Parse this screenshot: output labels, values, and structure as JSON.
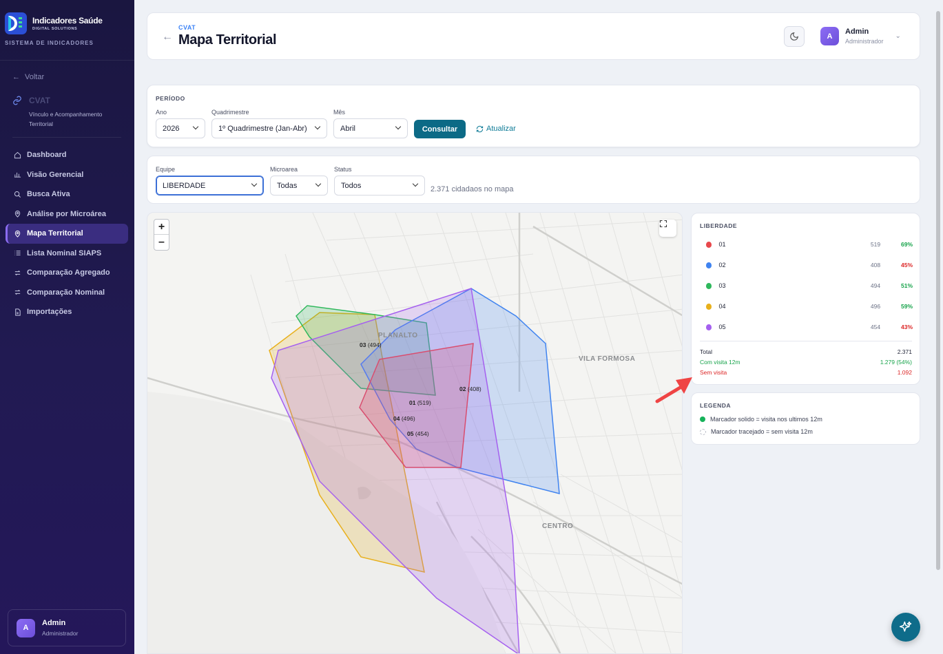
{
  "brand": {
    "name": "Indicadores Saúde",
    "sub": "DIGITAL SOLUTIONS",
    "system": "SISTEMA DE INDICADORES"
  },
  "sidebar": {
    "back_label": "Voltar",
    "module_title": "CVAT",
    "module_desc": "Vínculo e Acompanhamento Territorial",
    "items": [
      {
        "label": "Dashboard",
        "icon": "home-icon",
        "active": false
      },
      {
        "label": "Visão Gerencial",
        "icon": "bar-chart-icon",
        "active": false
      },
      {
        "label": "Busca Ativa",
        "icon": "search-icon",
        "active": false
      },
      {
        "label": "Análise por Microárea",
        "icon": "map-pin-icon",
        "active": false
      },
      {
        "label": "Mapa Territorial",
        "icon": "map-pin-icon",
        "active": true
      },
      {
        "label": "Lista Nominal SIAPS",
        "icon": "list-icon",
        "active": false
      },
      {
        "label": "Comparação Agregado",
        "icon": "arrows-icon",
        "active": false
      },
      {
        "label": "Comparação Nominal",
        "icon": "arrows-icon",
        "active": false
      },
      {
        "label": "Importações",
        "icon": "file-icon",
        "active": false
      }
    ],
    "user": {
      "initial": "A",
      "name": "Admin",
      "role": "Administrador"
    }
  },
  "header": {
    "crumb": "CVAT",
    "title": "Mapa Territorial",
    "user": {
      "initial": "A",
      "name": "Admin",
      "role": "Administrador"
    }
  },
  "period": {
    "section": "PERÍODO",
    "ano_label": "Ano",
    "ano_value": "2026",
    "quad_label": "Quadrimestre",
    "quad_value": "1º Quadrimestre (Jan-Abr)",
    "mes_label": "Mês",
    "mes_value": "Abril",
    "consultar": "Consultar",
    "atualizar": "Atualizar"
  },
  "filters": {
    "equipe_label": "Equipe",
    "equipe_value": "LIBERDADE",
    "micro_label": "Microarea",
    "micro_value": "Todas",
    "status_label": "Status",
    "status_value": "Todos",
    "count_text": "2.371 cidadaos no mapa"
  },
  "map": {
    "area_labels": [
      "PLANALTO",
      "VILA FORMOSA",
      "CENTRO"
    ],
    "polygons": [
      {
        "id": "01",
        "count": "(519)",
        "color": "#e8484c"
      },
      {
        "id": "02",
        "count": "(408)",
        "color": "#3f83f0"
      },
      {
        "id": "03",
        "count": "(494)",
        "color": "#2fb85c"
      },
      {
        "id": "04",
        "count": "(496)",
        "color": "#e8b01c"
      },
      {
        "id": "05",
        "count": "(454)",
        "color": "#a560ef"
      }
    ]
  },
  "stats": {
    "title": "LIBERDADE",
    "rows": [
      {
        "name": "01",
        "n": "519",
        "pct": "69%",
        "color": "#e8484c",
        "pct_color": "#16a34a"
      },
      {
        "name": "02",
        "n": "408",
        "pct": "45%",
        "color": "#3f83f0",
        "pct_color": "#dc2626"
      },
      {
        "name": "03",
        "n": "494",
        "pct": "51%",
        "color": "#2fb85c",
        "pct_color": "#16a34a"
      },
      {
        "name": "04",
        "n": "496",
        "pct": "59%",
        "color": "#e8b01c",
        "pct_color": "#16a34a"
      },
      {
        "name": "05",
        "n": "454",
        "pct": "43%",
        "color": "#a560ef",
        "pct_color": "#dc2626"
      }
    ],
    "total_label": "Total",
    "total_value": "2.371",
    "com_label": "Com visita 12m",
    "com_value": "1.279 (54%)",
    "sem_label": "Sem visita",
    "sem_value": "1.092"
  },
  "legend": {
    "title": "LEGENDA",
    "solid": "Marcador solido = visita nos ultimos 12m",
    "dashed": "Marcador tracejado = sem visita 12m"
  }
}
